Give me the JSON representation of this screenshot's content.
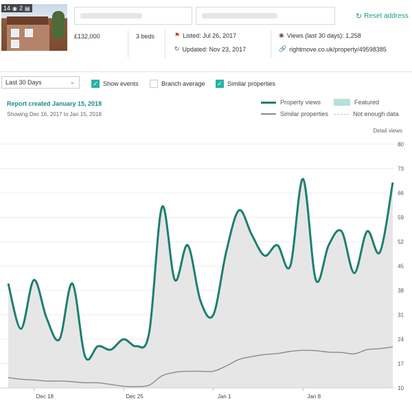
{
  "header": {
    "photo_count": "14",
    "floorplan_count": "2",
    "reset_label": "Reset address",
    "price": "£132,000",
    "beds": "3 beds",
    "listed": "Listed: Jul 26, 2017",
    "updated": "Updated: Nov 23, 2017",
    "views": "Views (last 30 days): 1,258",
    "url": "rightmove.co.uk/property/49598385",
    "icons": [
      "camera-icon",
      "floorplan-icon",
      "refresh-icon",
      "flag-icon",
      "clock-icon",
      "eye-icon",
      "link-icon"
    ]
  },
  "toolbar": {
    "range_selected": "Last 30 Days",
    "checkboxes": [
      {
        "label": "Show events",
        "checked": true
      },
      {
        "label": "Branch average",
        "checked": false
      },
      {
        "label": "Similar properties",
        "checked": true
      }
    ]
  },
  "report": {
    "title": "Report created January 15, 2018",
    "subtitle": "Showing Dec 16, 2017 to Jan 15, 2018",
    "detail_label": "Detail views"
  },
  "legend": {
    "property_views": "Property views",
    "featured": "Featured",
    "similar": "Similar properties",
    "not_enough": "Not enough data"
  },
  "colors": {
    "accent": "#1b7f6f",
    "fill": "#e6e6e6",
    "similar": "#8a8a8a",
    "featured": "#b8dfd9",
    "link": "#1b8c86"
  },
  "chart_data": {
    "type": "area",
    "ylabel": "Detail views",
    "ylim": [
      10,
      80
    ],
    "yticks": [
      10,
      17,
      24,
      31,
      38,
      45,
      52,
      59,
      66,
      73,
      80
    ],
    "x_tick_labels": [
      "Dec 18",
      "Dec 25",
      "Jan 1",
      "Jan 8"
    ],
    "x": [
      "Dec 16",
      "Dec 17",
      "Dec 18",
      "Dec 19",
      "Dec 20",
      "Dec 21",
      "Dec 22",
      "Dec 23",
      "Dec 24",
      "Dec 25",
      "Dec 26",
      "Dec 27",
      "Dec 28",
      "Dec 29",
      "Dec 30",
      "Dec 31",
      "Jan 1",
      "Jan 2",
      "Jan 3",
      "Jan 4",
      "Jan 5",
      "Jan 6",
      "Jan 7",
      "Jan 8",
      "Jan 9",
      "Jan 10",
      "Jan 11",
      "Jan 12",
      "Jan 13",
      "Jan 14",
      "Jan 15"
    ],
    "x_tick_indices": [
      2,
      9,
      16,
      23
    ],
    "series": [
      {
        "name": "Property views",
        "values": [
          40,
          27,
          41,
          30,
          24,
          40,
          19,
          22,
          21,
          24,
          22,
          26,
          62,
          41,
          51,
          35,
          31,
          49,
          61,
          54,
          48,
          51,
          45,
          70,
          41,
          51,
          55,
          43,
          55,
          49,
          69
        ]
      },
      {
        "name": "Similar properties",
        "values": [
          13,
          12.5,
          12.3,
          12,
          12,
          11.8,
          11.5,
          11.5,
          11,
          10.5,
          10.4,
          10.8,
          13.5,
          14.5,
          14.8,
          14.8,
          14.8,
          16.3,
          18.2,
          19,
          19.6,
          19.9,
          20.5,
          20.8,
          20.7,
          20.3,
          20.2,
          19.8,
          21,
          21.3,
          21.8
        ]
      }
    ]
  }
}
